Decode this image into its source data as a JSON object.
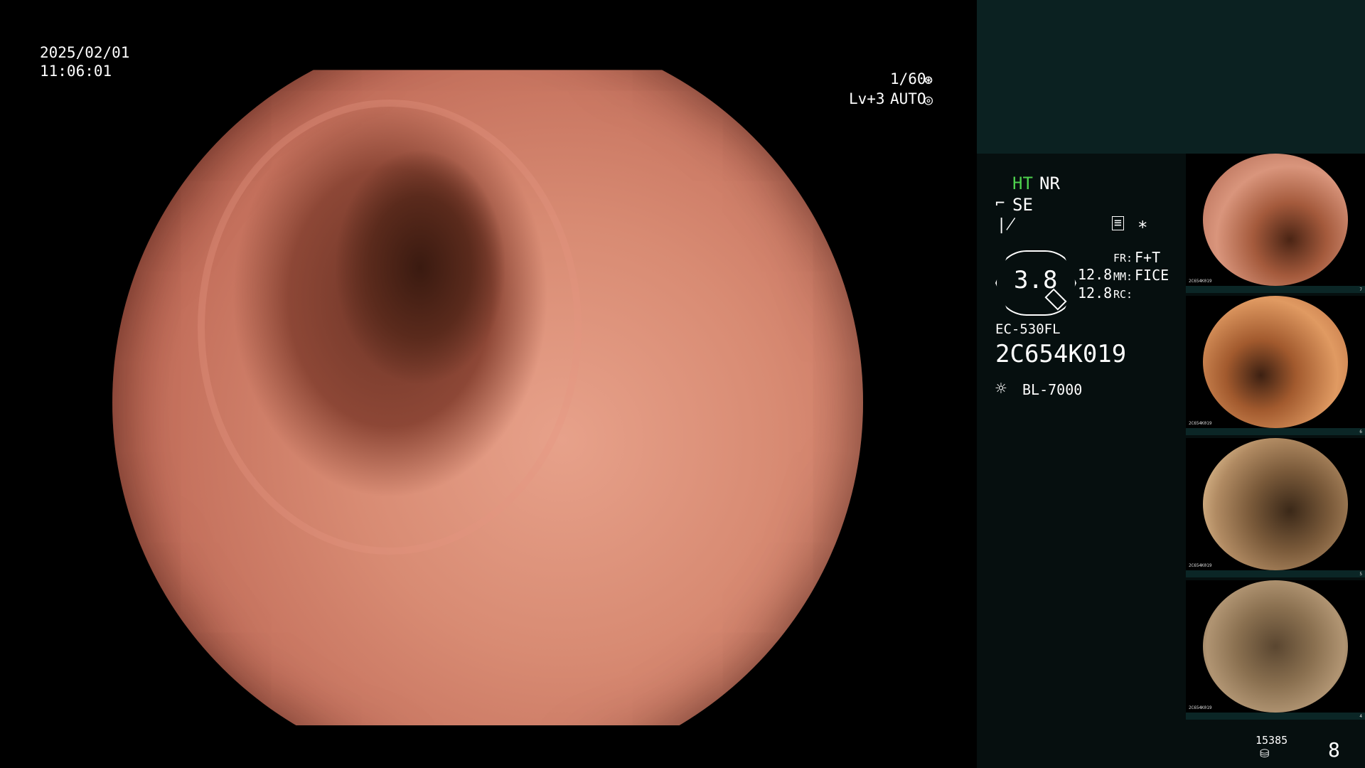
{
  "osd": {
    "date": "2025/02/01",
    "time": "11:06:01",
    "shutter": "1/60",
    "level": "Lv+3",
    "mode": "AUTO"
  },
  "panel": {
    "ht": "HT",
    "nr": "NR",
    "se": "SE",
    "star": "*",
    "brightness": "3.8",
    "val1": "12.8",
    "val2": "12.8",
    "fr_label": "FR:",
    "fr_value": "F+T",
    "mm_label": "MM:",
    "mm_value": "FICE",
    "rc_label": "RC:",
    "scope_model": "EC-530FL",
    "serial": "2C654K019",
    "light_source": "BL-7000",
    "storage_count": "15385",
    "image_count": "8"
  },
  "thumbnails": [
    {
      "serial": "2C654K019",
      "index": "7"
    },
    {
      "serial": "2C654K019",
      "index": "6"
    },
    {
      "serial": "2C654K019",
      "index": "5"
    },
    {
      "serial": "2C654K019",
      "index": "4"
    }
  ],
  "colors": {
    "panel_bg": "#060f0f",
    "panel_top": "#0b2121",
    "accent_green": "#4ed24e"
  },
  "icons": [
    "shutter-icon",
    "auto-icon",
    "scope-tip-icon",
    "function-icon",
    "storage-icon",
    "light-icon",
    "disk-icon"
  ]
}
